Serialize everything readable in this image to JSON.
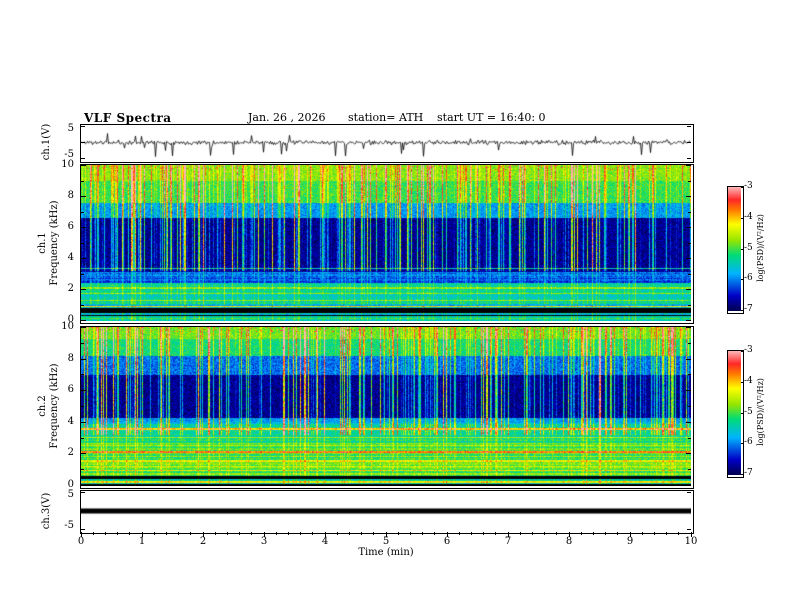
{
  "header": {
    "title": "VLF Spectra",
    "date": "Jan. 26 , 2026",
    "station": "station= ATH",
    "start_ut": "start UT =  16:40: 0"
  },
  "xaxis": {
    "label": "Time (min)",
    "ticks": [
      "0",
      "1",
      "2",
      "3",
      "4",
      "5",
      "6",
      "7",
      "8",
      "9",
      "10"
    ],
    "min": 0,
    "max": 10
  },
  "panels": {
    "wave1": {
      "ylabel": "ch.1(V)",
      "yticks": [
        "5",
        "-5"
      ],
      "ylim": [
        -5,
        5
      ]
    },
    "spec1": {
      "ylabel_line1": "ch.1",
      "ylabel_line2": "Frequency (kHz)",
      "yticks": [
        "10",
        "8",
        "6",
        "4",
        "2",
        "0"
      ],
      "ylim": [
        0,
        10
      ]
    },
    "spec2": {
      "ylabel_line1": "ch.2",
      "ylabel_line2": "Frequency (kHz)",
      "yticks": [
        "10",
        "8",
        "6",
        "4",
        "2",
        "0"
      ],
      "ylim": [
        0,
        10
      ]
    },
    "wave3": {
      "ylabel": "ch.3(V)",
      "yticks": [
        "5",
        "-5"
      ],
      "ylim": [
        -5,
        5
      ]
    }
  },
  "colorbar": {
    "label": "log(PSD)/(V²/Hz)",
    "ticks": [
      "-3",
      "-4",
      "-5",
      "-6",
      "-7"
    ],
    "min": -7,
    "max": -3
  },
  "colormap": {
    "stops": [
      {
        "p": 0.0,
        "color": "#000050"
      },
      {
        "p": 0.12,
        "color": "#0000c8"
      },
      {
        "p": 0.3,
        "color": "#00b4ff"
      },
      {
        "p": 0.45,
        "color": "#00dc78"
      },
      {
        "p": 0.57,
        "color": "#96e600"
      },
      {
        "p": 0.7,
        "color": "#ffff00"
      },
      {
        "p": 0.82,
        "color": "#ff7800"
      },
      {
        "p": 0.9,
        "color": "#ff2828"
      },
      {
        "p": 1.0,
        "color": "#ffb4b4"
      }
    ]
  },
  "chart_data": [
    {
      "type": "line",
      "name": "ch1_waveform",
      "ylabel": "ch.1(V)",
      "ylim": [
        -5,
        5
      ],
      "yticks": [
        5,
        -5
      ],
      "xlim": [
        0,
        10
      ],
      "xlabel": "Time (min)",
      "description": "broadband noise of ~±0.7 V about 0 V with impulsive sferic spikes reaching ±4 V",
      "noise_sigma": 0.3,
      "spike_rate": 0.03,
      "spike_max": 4.2,
      "seed": 11
    },
    {
      "type": "heatmap",
      "name": "ch1_spectrogram",
      "ylabel": "ch.1 Frequency (kHz)",
      "ylim": [
        0,
        10
      ],
      "yticks": [
        0,
        2,
        4,
        6,
        8,
        10
      ],
      "xlim": [
        0,
        10
      ],
      "zlabel": "log(PSD)/(V²/Hz)",
      "zlim": [
        -7,
        -3
      ],
      "description": "dense vertical sferic streaks; green band 7.5-10 kHz (~-5); dark blue 3-6.6 kHz (~-6.8); striped green/cyan 0-2.4 kHz (~-5.4); black notch bands near 0.3 and 0.5-0.8 kHz; red speckles at top edge",
      "bands": [
        {
          "f0": 9.0,
          "f1": 10.001,
          "level": -4.75
        },
        {
          "f0": 7.6,
          "f1": 9.0,
          "level": -5.05
        },
        {
          "f0": 6.6,
          "f1": 7.6,
          "level": -5.9
        },
        {
          "f0": 3.1,
          "f1": 6.6,
          "level": -6.75
        },
        {
          "f0": 2.4,
          "f1": 3.1,
          "level": -6.15
        },
        {
          "f0": 1.05,
          "f1": 2.4,
          "level": -5.45
        },
        {
          "f0": 0.8,
          "f1": 1.05,
          "level": -5.7
        },
        {
          "f0": 0.5,
          "f1": 0.8,
          "level": -7.5
        },
        {
          "f0": 0.38,
          "f1": 0.5,
          "level": -5.6
        },
        {
          "f0": 0.28,
          "f1": 0.38,
          "level": -7.5
        },
        {
          "f0": 0.0,
          "f1": 0.28,
          "level": -5.3
        }
      ],
      "hlines": [
        {
          "f": 3.35,
          "w": 0.04,
          "level": -5.5
        },
        {
          "f": 2.1,
          "w": 0.05,
          "level": -4.6
        },
        {
          "f": 1.75,
          "w": 0.04,
          "level": -4.9
        },
        {
          "f": 1.3,
          "w": 0.05,
          "level": -4.7
        },
        {
          "f": 0.92,
          "w": 0.04,
          "level": -4.3
        },
        {
          "f": 0.15,
          "w": 0.04,
          "level": -4.8
        }
      ],
      "stripe_fmax": 3.2,
      "stripe_amp": 0.45,
      "sferic_density": 0.4,
      "seed": 7
    },
    {
      "type": "heatmap",
      "name": "ch2_spectrogram",
      "ylabel": "ch.2 Frequency (kHz)",
      "ylim": [
        0,
        10
      ],
      "yticks": [
        0,
        2,
        4,
        6,
        8,
        10
      ],
      "xlim": [
        0,
        10
      ],
      "zlabel": "log(PSD)/(V²/Hz)",
      "zlim": [
        -7,
        -3
      ],
      "description": "like ch.1 but with strong horizontal emission lines (yellow/orange) between 0.7 and 3.6 kHz, black notch band near 0.4-0.6 kHz, dark blue 4.3-7 kHz, green 8-10 kHz",
      "bands": [
        {
          "f0": 9.3,
          "f1": 10.001,
          "level": -4.85
        },
        {
          "f0": 8.2,
          "f1": 9.3,
          "level": -5.2
        },
        {
          "f0": 7.0,
          "f1": 8.2,
          "level": -6.1
        },
        {
          "f0": 4.3,
          "f1": 7.0,
          "level": -6.75
        },
        {
          "f0": 3.9,
          "f1": 4.3,
          "level": -5.9
        },
        {
          "f0": 2.7,
          "f1": 3.9,
          "level": -5.35
        },
        {
          "f0": 0.62,
          "f1": 2.7,
          "level": -5.0
        },
        {
          "f0": 0.38,
          "f1": 0.62,
          "level": -7.5
        },
        {
          "f0": 0.1,
          "f1": 0.38,
          "level": -5.4
        },
        {
          "f0": 0.0,
          "f1": 0.1,
          "level": -7.3
        }
      ],
      "hlines": [
        {
          "f": 3.55,
          "w": 0.06,
          "level": -4.0
        },
        {
          "f": 3.05,
          "w": 0.04,
          "level": -4.7
        },
        {
          "f": 2.55,
          "w": 0.04,
          "level": -4.4
        },
        {
          "f": 2.1,
          "w": 0.06,
          "level": -3.8
        },
        {
          "f": 1.85,
          "w": 0.04,
          "level": -4.5
        },
        {
          "f": 1.55,
          "w": 0.05,
          "level": -4.1
        },
        {
          "f": 1.2,
          "w": 0.04,
          "level": -4.6
        },
        {
          "f": 0.95,
          "w": 0.04,
          "level": -4.2
        },
        {
          "f": 0.72,
          "w": 0.04,
          "level": -4.5
        },
        {
          "f": 0.22,
          "w": 0.04,
          "level": -4.3
        }
      ],
      "stripe_fmax": 4.0,
      "stripe_amp": 0.5,
      "sferic_density": 0.38,
      "seed": 23
    },
    {
      "type": "line",
      "name": "ch3_waveform",
      "ylabel": "ch.3(V)",
      "ylim": [
        -5,
        5
      ],
      "yticks": [
        5,
        -5
      ],
      "xlim": [
        0,
        10
      ],
      "xlabel": "Time (min)",
      "description": "flat thick black trace at 0 V for the whole record",
      "constant_value": 0
    }
  ]
}
